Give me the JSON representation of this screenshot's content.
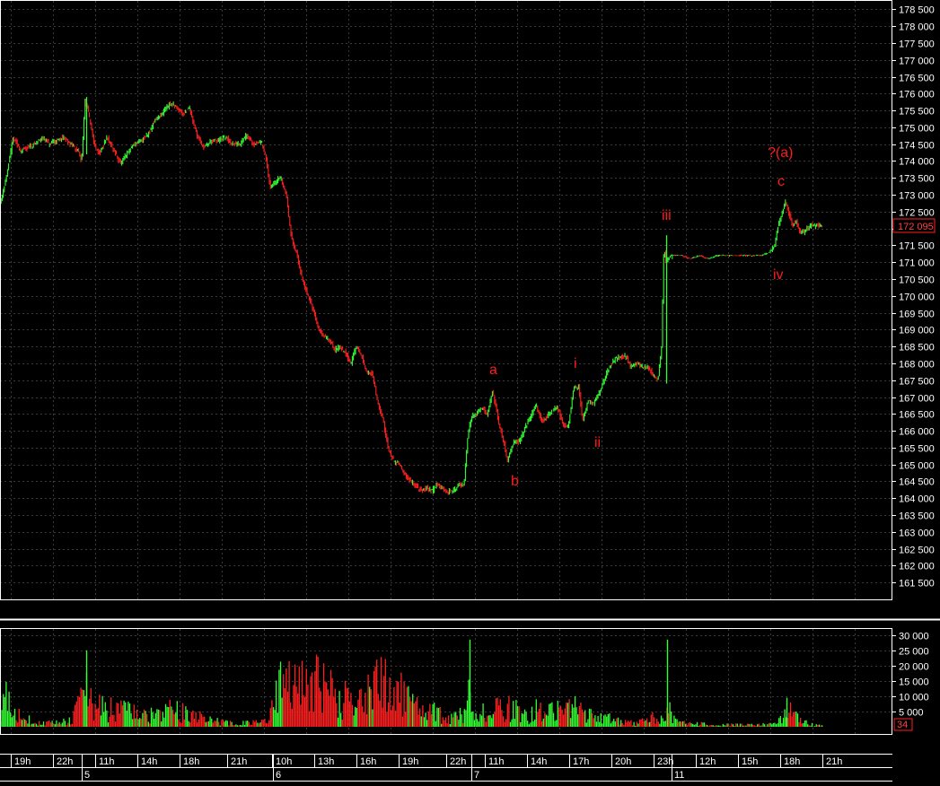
{
  "chart_data": [
    {
      "type": "candlestick",
      "name": "price",
      "ylim": [
        161000,
        178750
      ],
      "y_ticks": [
        161500,
        162000,
        162500,
        163000,
        163500,
        164000,
        164500,
        165000,
        165500,
        166000,
        166500,
        167000,
        167500,
        168000,
        168500,
        169000,
        169500,
        170000,
        170500,
        171000,
        171500,
        172000,
        172500,
        173000,
        173500,
        174000,
        174500,
        175000,
        175500,
        176000,
        176500,
        177000,
        177500,
        178000,
        178500
      ],
      "y_tick_labels": [
        "161 500",
        "162 000",
        "162 500",
        "163 000",
        "163 500",
        "164 000",
        "164 500",
        "165 000",
        "165 500",
        "166 000",
        "166 500",
        "167 000",
        "167 500",
        "168 000",
        "168 500",
        "169 000",
        "169 500",
        "170 000",
        "170 500",
        "171 000",
        "171 500",
        "172 000",
        "172 500",
        "173 000",
        "173 500",
        "174 000",
        "174 500",
        "175 000",
        "175 500",
        "176 000",
        "176 500",
        "177 000",
        "177 500",
        "178 000",
        "178 500"
      ],
      "last_price": 172095,
      "last_price_label": "172 095",
      "up_color": "#33ff33",
      "down_color": "#ff2020",
      "grid": true,
      "path_x": [
        0,
        8,
        16,
        24,
        32,
        40,
        48,
        56,
        64,
        72,
        80,
        88,
        92,
        96,
        100,
        106,
        112,
        120,
        128,
        136,
        142,
        150,
        158,
        166,
        174,
        182,
        190,
        198,
        205,
        212,
        220,
        228,
        236,
        244,
        252,
        260,
        268,
        276,
        284,
        292,
        298,
        302,
        308,
        314,
        320,
        326,
        332,
        338,
        344,
        350,
        356,
        362,
        368,
        374,
        380,
        386,
        392,
        398,
        404,
        410,
        416,
        422,
        428,
        434,
        440,
        446,
        452,
        458,
        464,
        470,
        476,
        482,
        488,
        494,
        500,
        506,
        512,
        518,
        522,
        526,
        532,
        538,
        544,
        550,
        556,
        562,
        566,
        570,
        574,
        580,
        586,
        592,
        598,
        604,
        610,
        616,
        622,
        628,
        634,
        640,
        646,
        650,
        656,
        662,
        668,
        674,
        680,
        686,
        692,
        698,
        704,
        710,
        716,
        722,
        728,
        734,
        738,
        741,
        742,
        744,
        750,
        760,
        770,
        780,
        790,
        800,
        810,
        820,
        830,
        840,
        850,
        858,
        864,
        868,
        872,
        876,
        880,
        884,
        888,
        892,
        896,
        900,
        906,
        912,
        916
      ],
      "path_y": [
        172600,
        173500,
        174700,
        174300,
        174400,
        174500,
        174700,
        174500,
        174600,
        174700,
        174500,
        174300,
        174000,
        175800,
        175400,
        174500,
        174200,
        174700,
        174300,
        173900,
        174200,
        174500,
        174600,
        174800,
        175200,
        175400,
        175700,
        175600,
        175400,
        175600,
        174800,
        174400,
        174600,
        174600,
        174700,
        174500,
        174500,
        174800,
        174500,
        174600,
        174000,
        173200,
        173400,
        173500,
        173000,
        171700,
        171200,
        170500,
        170000,
        169600,
        169000,
        168800,
        168700,
        168400,
        168500,
        168300,
        168000,
        168500,
        168200,
        167700,
        167700,
        166800,
        166300,
        165400,
        165100,
        165000,
        164700,
        164500,
        164400,
        164200,
        164300,
        164200,
        164400,
        164300,
        164200,
        164200,
        164400,
        164400,
        165800,
        166400,
        166500,
        166700,
        166500,
        167200,
        166300,
        165700,
        165100,
        165400,
        165700,
        165700,
        166100,
        166400,
        166800,
        166300,
        166400,
        166600,
        166700,
        166200,
        166100,
        167300,
        167300,
        166300,
        166900,
        166800,
        167100,
        167500,
        167900,
        168100,
        168200,
        168200,
        167900,
        168000,
        167900,
        167900,
        167700,
        167500,
        168500,
        171800,
        171000,
        171100,
        171200,
        171200,
        171100,
        171200,
        171100,
        171200,
        171200,
        171200,
        171200,
        171200,
        171200,
        171300,
        171500,
        172100,
        172400,
        172800,
        172400,
        172100,
        172200,
        171900,
        171900,
        172000,
        172100,
        172100,
        172100
      ]
    },
    {
      "type": "bar",
      "name": "volume",
      "ylim": [
        0,
        32000
      ],
      "y_ticks": [
        5000,
        10000,
        15000,
        20000,
        25000,
        30000
      ],
      "y_tick_labels": [
        "5 000",
        "10 000",
        "15 000",
        "20 000",
        "25 000",
        "30 000"
      ],
      "last_value": 34,
      "last_value_label": "34",
      "envelope_x": [
        0,
        10,
        20,
        30,
        40,
        60,
        80,
        90,
        95,
        100,
        110,
        120,
        130,
        140,
        150,
        160,
        170,
        180,
        190,
        200,
        210,
        220,
        230,
        240,
        250,
        260,
        270,
        280,
        290,
        300,
        305,
        310,
        320,
        330,
        340,
        350,
        360,
        370,
        380,
        390,
        400,
        410,
        420,
        430,
        440,
        450,
        460,
        470,
        480,
        490,
        500,
        510,
        520,
        523,
        526,
        530,
        540,
        550,
        560,
        570,
        580,
        590,
        600,
        610,
        620,
        630,
        640,
        650,
        660,
        670,
        680,
        690,
        700,
        710,
        720,
        730,
        740,
        743,
        746,
        750,
        760,
        780,
        800,
        820,
        840,
        860,
        866,
        872,
        878,
        884,
        890,
        900,
        910,
        916
      ],
      "envelope_y": [
        12000,
        16000,
        6000,
        4000,
        2000,
        2000,
        3000,
        14000,
        22000,
        12000,
        10000,
        9000,
        9000,
        8000,
        7000,
        6000,
        6000,
        5000,
        9000,
        8000,
        6000,
        5000,
        4000,
        3000,
        2000,
        2000,
        2000,
        2000,
        2000,
        3000,
        22000,
        20000,
        21000,
        20000,
        22000,
        25000,
        20000,
        19000,
        16000,
        11000,
        13000,
        16000,
        21000,
        24000,
        18000,
        16000,
        11000,
        10000,
        8000,
        6000,
        4000,
        6000,
        10000,
        16000,
        9000,
        7000,
        8000,
        14000,
        9000,
        10000,
        7000,
        5000,
        10000,
        8000,
        9000,
        7000,
        10000,
        6000,
        6000,
        4000,
        4000,
        3000,
        2000,
        2000,
        3000,
        5000,
        4000,
        12000,
        8000,
        4000,
        2000,
        1500,
        1000,
        1000,
        1000,
        1200,
        3000,
        6000,
        9000,
        6000,
        4000,
        1500,
        1000,
        500
      ],
      "spikes": [
        [
          523,
          28500
        ],
        [
          743,
          28500
        ],
        [
          876,
          9500
        ],
        [
          96,
          25000
        ]
      ]
    }
  ],
  "x_axis": {
    "hour_labels": [
      "19h",
      "22h",
      "11h",
      "14h",
      "18h",
      "21h",
      "10h",
      "13h",
      "16h",
      "19h",
      "22h",
      "11h",
      "14h",
      "17h",
      "20h",
      "23h",
      "12h",
      "15h",
      "18h",
      "21h"
    ],
    "day_labels": [
      "5",
      "6",
      "7",
      "11"
    ]
  },
  "annotations": [
    "?(a)",
    "c",
    "iii",
    "iv",
    "a",
    "i",
    "b",
    "ii"
  ]
}
